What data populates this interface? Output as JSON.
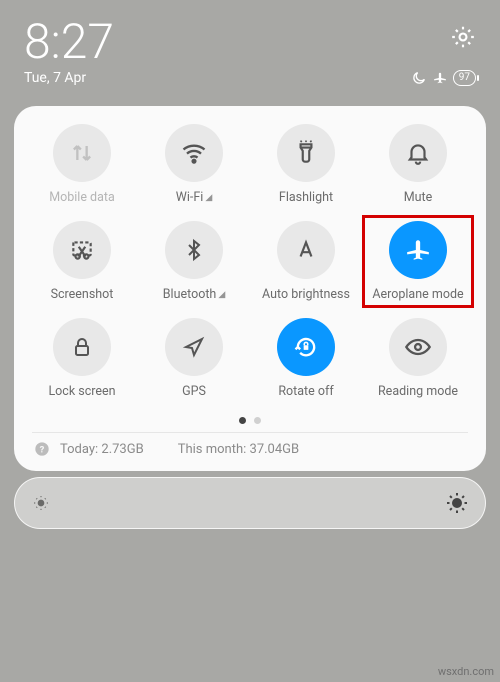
{
  "status": {
    "time": "8:27",
    "date": "Tue, 7 Apr",
    "battery": "97"
  },
  "tiles": [
    {
      "label": "Mobile data"
    },
    {
      "label": "Wi-Fi"
    },
    {
      "label": "Flashlight"
    },
    {
      "label": "Mute"
    },
    {
      "label": "Screenshot"
    },
    {
      "label": "Bluetooth"
    },
    {
      "label": "Auto brightness"
    },
    {
      "label": "Aeroplane mode"
    },
    {
      "label": "Lock screen"
    },
    {
      "label": "GPS"
    },
    {
      "label": "Rotate off"
    },
    {
      "label": "Reading mode"
    }
  ],
  "usage": {
    "today_label": "Today:",
    "today_value": "2.73GB",
    "month_label": "This month:",
    "month_value": "37.04GB"
  },
  "watermark": "wsxdn.com"
}
